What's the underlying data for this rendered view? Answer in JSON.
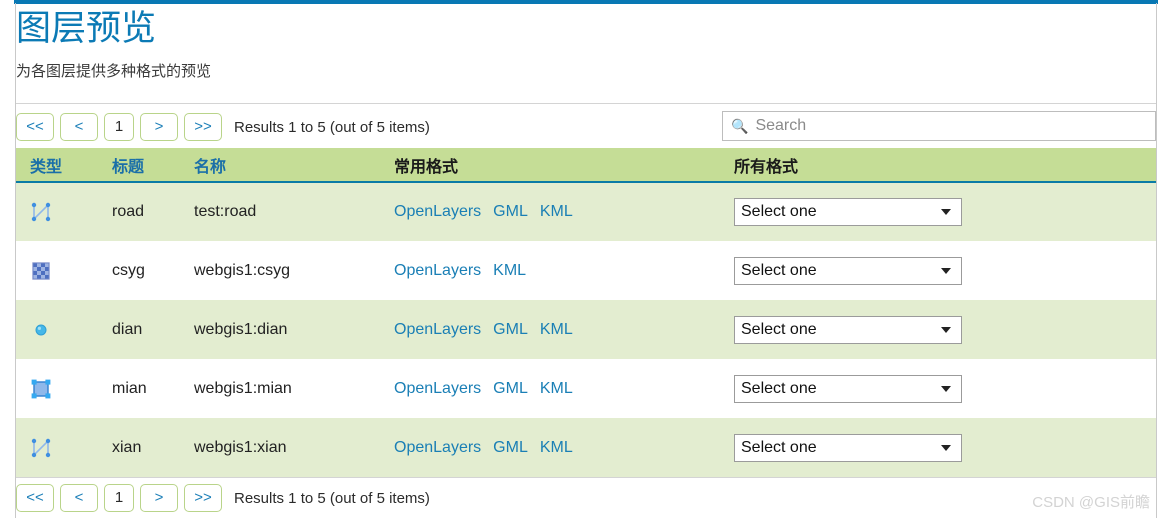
{
  "page": {
    "title": "图层预览",
    "subtitle": "为各图层提供多种格式的预览"
  },
  "pager": {
    "first_label": "<<",
    "prev_label": "<",
    "page_label": "1",
    "next_label": ">",
    "last_label": ">>",
    "results_text": "Results 1 to 5 (out of 5 items)"
  },
  "search": {
    "icon": "search-icon",
    "placeholder": "Search",
    "value": ""
  },
  "table": {
    "headers": [
      {
        "label": "类型",
        "sortable": true
      },
      {
        "label": "标题",
        "sortable": true
      },
      {
        "label": "名称",
        "sortable": true
      },
      {
        "label": "常用格式",
        "sortable": false
      },
      {
        "label": "所有格式",
        "sortable": false
      }
    ],
    "select_placeholder": "Select one",
    "rows": [
      {
        "geom": "polyline",
        "title": "road",
        "name": "test:road",
        "formats": [
          "OpenLayers",
          "GML",
          "KML"
        ],
        "select": "Select one"
      },
      {
        "geom": "raster",
        "title": "csyg",
        "name": "webgis1:csyg",
        "formats": [
          "OpenLayers",
          "KML"
        ],
        "select": "Select one"
      },
      {
        "geom": "point",
        "title": "dian",
        "name": "webgis1:dian",
        "formats": [
          "OpenLayers",
          "GML",
          "KML"
        ],
        "select": "Select one"
      },
      {
        "geom": "polygon",
        "title": "mian",
        "name": "webgis1:mian",
        "formats": [
          "OpenLayers",
          "GML",
          "KML"
        ],
        "select": "Select one"
      },
      {
        "geom": "polyline",
        "title": "xian",
        "name": "webgis1:xian",
        "formats": [
          "OpenLayers",
          "GML",
          "KML"
        ],
        "select": "Select one"
      }
    ]
  },
  "watermark": "CSDN @GIS前瞻",
  "colors": {
    "title_blue": "#0b7ab5",
    "header_green": "#c5dd96",
    "row_green": "#e3edd0",
    "link_blue": "#1a7fb5",
    "rule_teal": "#0a7ba5"
  }
}
